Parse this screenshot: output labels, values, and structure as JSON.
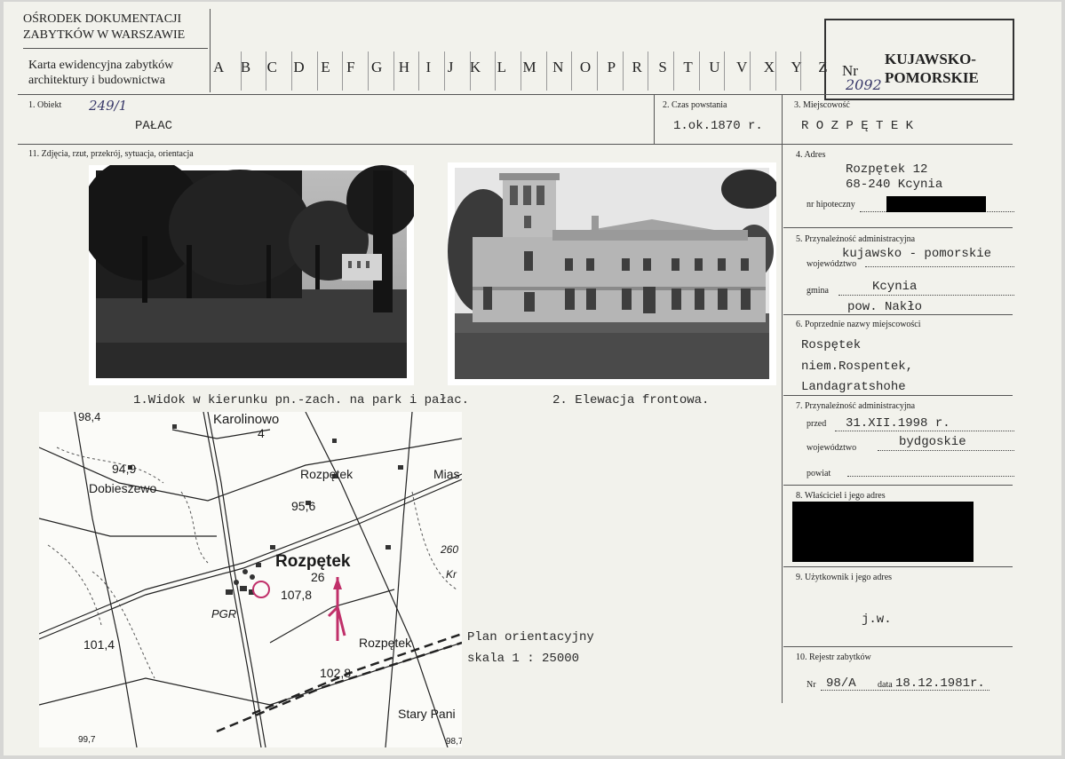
{
  "header": {
    "institution_line1": "OŚRODEK DOKUMENTACJI",
    "institution_line2": "ZABYTKÓW W WARSZAWIE",
    "card_title_line1": "Karta ewidencyjna zabytków",
    "card_title_line2": "architektury i budownictwa",
    "alphabet": [
      "A",
      "B",
      "C",
      "D",
      "E",
      "F",
      "G",
      "H",
      "I",
      "J",
      "K",
      "L",
      "M",
      "N",
      "O",
      "P",
      "R",
      "S",
      "T",
      "U",
      "V",
      "X",
      "Y",
      "Z"
    ],
    "nr_label": "Nr",
    "nr_value": "2092",
    "region_line1": "KUJAWSKO-",
    "region_line2": "POMORSKIE"
  },
  "fields": {
    "obiekt_label": "1. Obiekt",
    "obiekt_number": "249/1",
    "obiekt_value": "PAŁAC",
    "czas_label": "2. Czas powstania",
    "czas_value": "1.ok.1870 r.",
    "miejscowosc_label": "3. Miejscowość",
    "miejscowosc_value": "R O Z P Ę T E K",
    "zdjecia_label": "11. Zdjęcia, rzut, przekrój, sytuacja, orientacja",
    "adres_label": "4. Adres",
    "adres_line1": "Rozpętek 12",
    "adres_line2": "68-240 Kcynia",
    "hipoteczny_label": "nr hipoteczny",
    "admin_label": "5. Przynależność administracyjna",
    "admin_woj_value": "kujawsko - pomorskie",
    "admin_woj_label": "województwo",
    "gmina_label": "gmina",
    "gmina_value": "Kcynia",
    "powiat_value": "pow. Nakło",
    "poprzednie_label": "6. Poprzednie nazwy miejscowości",
    "poprzednie_line1": "Rospętek",
    "poprzednie_line2": "niem.Rospentek,",
    "poprzednie_line3": "Landagratshohe",
    "admin_prev_label": "7. Przynależność administracyjna",
    "przed_label": "przed",
    "przed_value": "31.XII.1998 r.",
    "woj_prev_label": "województwo",
    "woj_prev_value": "bydgoskie",
    "powiat_label": "powiat",
    "wlasciciel_label": "8. Właściciel i jego adres",
    "uzytkownik_label": "9. Użytkownik i jego adres",
    "uzytkownik_value": "j.w.",
    "rejestr_label": "10. Rejestr zabytków",
    "rejestr_nr_label": "Nr",
    "rejestr_nr_value": "98/A",
    "rejestr_data_label": "data",
    "rejestr_data_value": "18.12.1981r."
  },
  "photos": {
    "caption1": "1.Widok w kierunku pn.-zach. na park i pałac.",
    "caption2": "2. Elewacja frontowa."
  },
  "map": {
    "labels": [
      "98,4",
      "Karolinowo",
      "4",
      "94,9",
      "Dobieszewo",
      "Rozpętek",
      "95,6",
      "Mias",
      "Rozpętek",
      "26",
      "107,8",
      "PGR",
      "101,4",
      "Rozpętek",
      "102,8",
      "Stary Pani",
      "260",
      "Kr",
      "99,7",
      "98,7"
    ],
    "plan_label": "Plan orientacyjny",
    "scale_label": "skala 1 : 25000"
  },
  "colors": {
    "paper": "#f2f2ec",
    "map_marker": "#c0306a",
    "ink_blue": "#3a3a6a"
  }
}
